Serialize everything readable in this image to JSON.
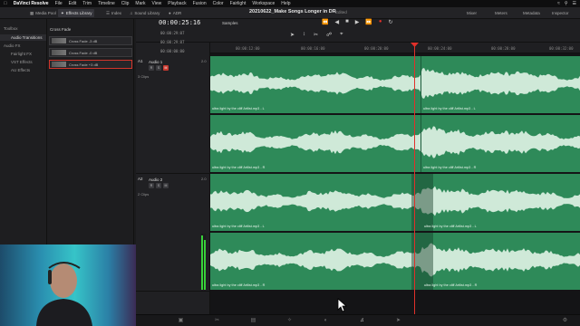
{
  "menubar": {
    "app": "DaVinci Resolve",
    "items": [
      "File",
      "Edit",
      "Trim",
      "Timeline",
      "Clip",
      "Mark",
      "View",
      "Playback",
      "Fusion",
      "Color",
      "Fairlight",
      "Workspace",
      "Help"
    ]
  },
  "toolbar": {
    "media_pool": "Media Pool",
    "effects_library": "Effects Library",
    "index": "Index",
    "sound_library": "Sound Library",
    "adr": "ADR",
    "project_title": "20210622_Make Songs Longer in DR",
    "project_status": "Edited",
    "mixer": "Mixer",
    "meters": "Meters",
    "metadata": "Metadata",
    "inspector": "Inspector"
  },
  "sidebar": {
    "toolbox": "Toolbox",
    "audio_transitions": "Audio Transitions",
    "audio_fx": "Audio FX",
    "fairlight_fx": "Fairlight FX",
    "vst_effects": "VST Effects",
    "au_effects": "AU Effects"
  },
  "effects": {
    "header": "Cross Fade",
    "items": [
      {
        "label": "Cross Fade -3 dB"
      },
      {
        "label": "Cross Fade -0 dB"
      },
      {
        "label": "Cross Fade +3 dB"
      }
    ]
  },
  "timeline": {
    "timecode": "00:00:25:16",
    "bin": "Samples",
    "side_timecodes": [
      "00:00:29:07",
      "00:00:29:07",
      "00:00:00:00"
    ],
    "ruler_ticks": [
      "00:00:12:00",
      "00:00:16:00",
      "00:00:20:00",
      "00:00:24:00",
      "00:00:28:00",
      "00:00:32:00"
    ],
    "playhead": "00:00:25:16"
  },
  "tracks": [
    {
      "id": "A1",
      "name": "Audio 1",
      "vol": "2.0",
      "clips": "3 Clips",
      "lanes": [
        {
          "clip_a": "ultra light by the cliff Artlist.mp3 - L",
          "clip_b": "ultra light by the cliff Artlist.mp3 - L"
        },
        {
          "clip_a": "ultra light by the cliff Artlist.mp3 - R",
          "clip_b": "ultra light by the cliff Artlist.mp3 - R"
        }
      ]
    },
    {
      "id": "A2",
      "name": "Audio 2",
      "vol": "2.0",
      "clips": "2 Clips",
      "lanes": [
        {
          "clip_a": "ultra light by the cliff Artlist.mp3 - L",
          "clip_b": "ultra light by the cliff Artlist.mp3 - L"
        },
        {
          "clip_a": "ultra light by the cliff Artlist.mp3 - R",
          "clip_b": "ultra light by the cliff Artlist.mp3 - R"
        }
      ]
    }
  ],
  "colors": {
    "clip": "#2e8a59",
    "wave": "#cfe9d8",
    "playhead": "#e0302a",
    "mute": "#c8392f"
  }
}
